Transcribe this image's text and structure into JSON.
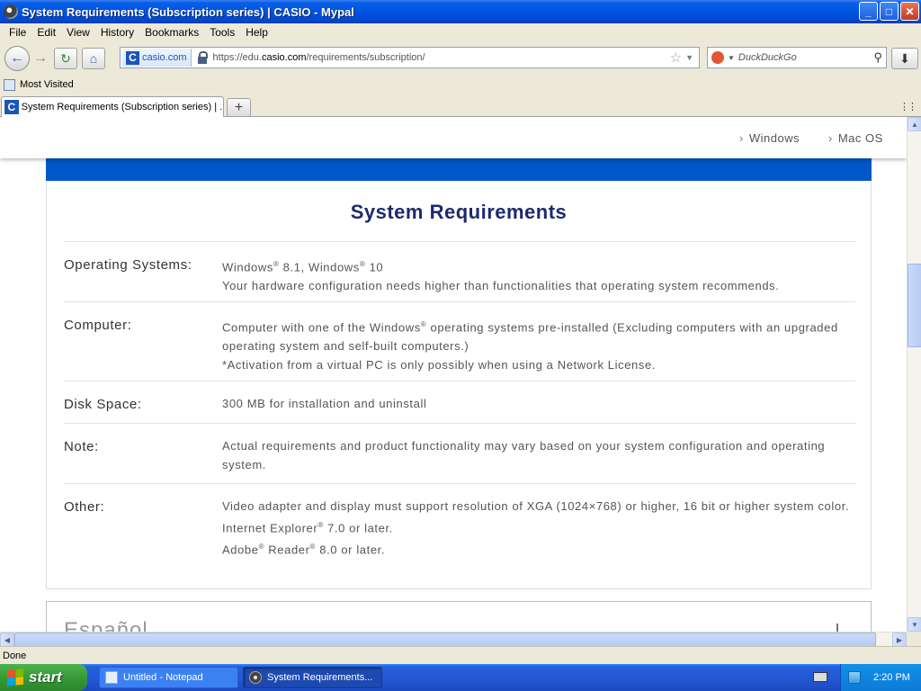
{
  "window": {
    "title": "System Requirements (Subscription series) | CASIO - Mypal",
    "buttons": {
      "minimize": "_",
      "maximize": "□",
      "close": "✕"
    }
  },
  "menu": [
    "File",
    "Edit",
    "View",
    "History",
    "Bookmarks",
    "Tools",
    "Help"
  ],
  "navbar": {
    "site_name": "casio.com",
    "url_prefix": "https://edu.",
    "url_host": "casio.com",
    "url_path": "/requirements/subscription/",
    "search_placeholder": "DuckDuckGo"
  },
  "bookmarks": {
    "most_visited": "Most Visited"
  },
  "tab": {
    "label": "System Requirements (Subscription series) | ..."
  },
  "page": {
    "os_links": [
      "Windows",
      "Mac OS"
    ],
    "title": "System Requirements",
    "requirements": [
      {
        "label": "Operating Systems:",
        "lines": [
          {
            "parts": [
              "Windows",
              "®",
              " 8.1, Windows",
              "®",
              " 10"
            ]
          },
          {
            "text": "Your hardware configuration needs higher than functionalities that operating system recommends."
          }
        ]
      },
      {
        "label": "Computer:",
        "lines": [
          {
            "parts": [
              "Computer with one of the Windows",
              "®",
              " operating systems pre-installed (Excluding computers with an upgraded operating system and self-built computers.)"
            ]
          },
          {
            "text": "*Activation from a virtual PC is only possibly when using a Network License."
          }
        ]
      },
      {
        "label": "Disk Space:",
        "lines": [
          {
            "text": "300 MB for installation and uninstall"
          }
        ]
      },
      {
        "label": "Note:",
        "lines": [
          {
            "text": "Actual requirements and product functionality may vary based on your system configuration and operating system."
          }
        ]
      },
      {
        "label": "Other:",
        "lines": [
          {
            "text": "Video adapter and display must support resolution of XGA (1024×768) or higher, 16 bit or higher system color."
          },
          {
            "parts": [
              "Internet Explorer",
              "®",
              " 7.0 or later."
            ]
          },
          {
            "parts": [
              "Adobe",
              "®",
              " Reader",
              "®",
              " 8.0 or later."
            ]
          }
        ]
      }
    ],
    "next_section_title": "Español"
  },
  "statusbar": {
    "text": "Done"
  },
  "taskbar": {
    "start": "start",
    "tasks": [
      "Untitled - Notepad",
      "System Requirements..."
    ],
    "clock": "2:20 PM"
  },
  "colors": {
    "accent": "#0057c8",
    "title": "#1c2a6e"
  }
}
